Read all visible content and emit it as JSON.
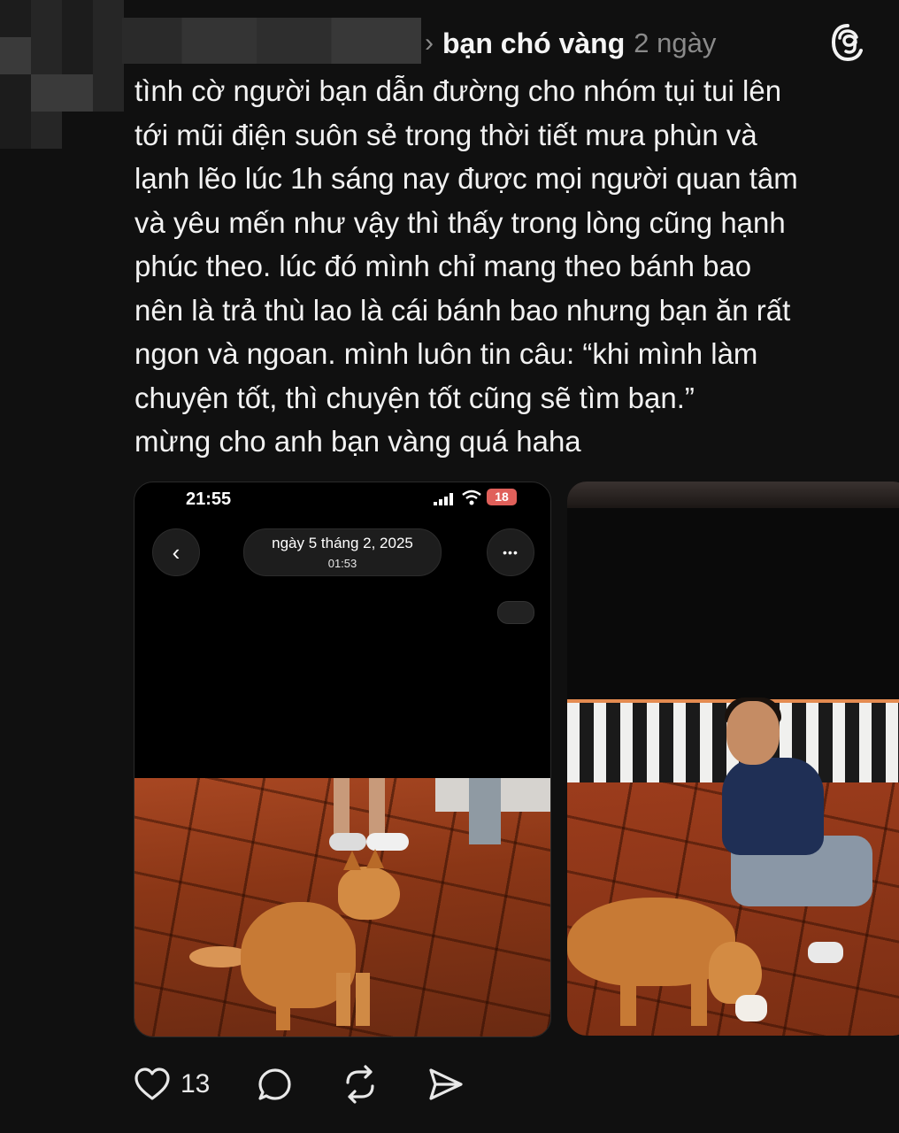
{
  "post": {
    "username": "bạn chó vàng",
    "time": "2 ngày",
    "text": "tình cờ người bạn dẫn đường cho nhóm tụi tui lên\ntới mũi điện suôn sẻ trong thời tiết mưa phùn và\nlạnh lẽo lúc 1h sáng nay được mọi người quan tâm\nvà yêu mến như vậy thì thấy trong lòng cũng hạnh\nphúc theo. lúc đó mình chỉ mang theo bánh bao\nnên là trả thù lao là cái bánh bao nhưng bạn ăn rất\nngon và ngoan. mình luôn tin câu: “khi mình làm\nchuyện tốt, thì chuyện tốt cũng sẽ tìm bạn.”\nmừng cho anh bạn vàng quá haha",
    "like_count": "13",
    "logo": "threads-icon"
  },
  "screenshot": {
    "status_time": "21:55",
    "battery": "18",
    "date_title": "ngày 5 tháng 2, 2025",
    "date_time": "01:53",
    "more_label": "•••",
    "back_label": "‹"
  },
  "icons": {
    "like": "heart-icon",
    "reply": "comment-icon",
    "repost": "repost-icon",
    "share": "send-icon"
  },
  "colors": {
    "background": "#101010",
    "text": "#f2f2f2",
    "muted": "#8a8a8a",
    "battery": "#e0605a"
  }
}
